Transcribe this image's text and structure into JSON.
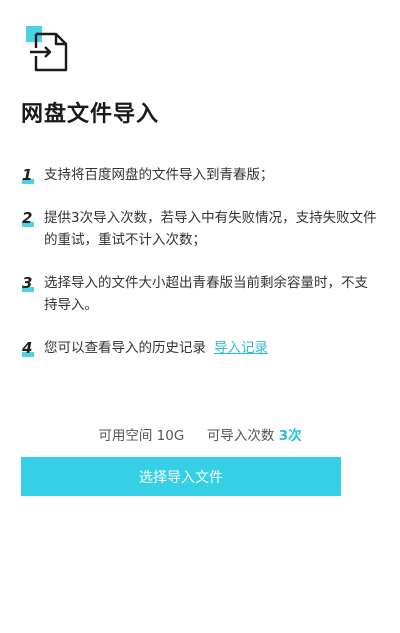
{
  "colors": {
    "accent": "#35d0e6",
    "link": "#2bbfd3",
    "text": "#222222"
  },
  "header": {
    "icon": "file-import-icon",
    "title": "网盘文件导入"
  },
  "steps": [
    {
      "num": "1",
      "text": "支持将百度网盘的文件导入到青春版；"
    },
    {
      "num": "2",
      "text": "提供3次导入次数，若导入中有失败情况，支持失败文件的重试，重试不计入次数；"
    },
    {
      "num": "3",
      "text": "选择导入的文件大小超出青春版当前剩余容量时，不支持导入。"
    },
    {
      "num": "4",
      "text": "您可以查看导入的历史记录",
      "link": "导入记录"
    }
  ],
  "stats": {
    "space_label": "可用空间",
    "space_value": "10G",
    "count_label": "可导入次数",
    "count_value": "3次"
  },
  "action": {
    "button_label": "选择导入文件"
  }
}
